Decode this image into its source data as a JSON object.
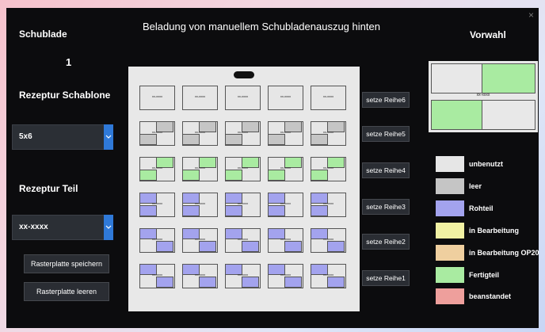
{
  "window": {
    "close_label": "×"
  },
  "sidebar": {
    "drawer_label": "Schublade",
    "drawer_number": "1",
    "template_label": "Rezeptur Schablone",
    "template_value": "5x6",
    "part_label": "Rezeptur Teil",
    "part_value": "xx-xxxx",
    "save_button": "Rasterplatte speichern",
    "clear_button": "Rasterplatte leeren"
  },
  "main": {
    "title": "Beladung von manuellem Schubladenauszug hinten",
    "cell_text": "xx-xxxx",
    "rows": [
      {
        "button": "setze Reihe6",
        "state": "unbenutzt"
      },
      {
        "button": "setze Reihe5",
        "state": "leer"
      },
      {
        "button": "setze Reihe4",
        "state": "Fertigteil"
      },
      {
        "button": "setze Reihe3",
        "state": "Rohteil"
      },
      {
        "button": "setze Reihe2",
        "state": "Rohteil"
      },
      {
        "button": "setze Reihe1",
        "state": "Rohteil"
      }
    ]
  },
  "preview": {
    "title": "Vorwahl",
    "cell_text": "xx-xxxx"
  },
  "legend": [
    {
      "label": "unbenutzt",
      "color": "#e6e6e6"
    },
    {
      "label": "leer",
      "color": "#c5c5c5"
    },
    {
      "label": "Rohteil",
      "color": "#a3a3ee"
    },
    {
      "label": "in Bearbeitung",
      "color": "#f1f1a3"
    },
    {
      "label": "in Bearbeitung OP20",
      "color": "#efcf9f"
    },
    {
      "label": "Fertigteil",
      "color": "#a9eba1"
    },
    {
      "label": "beanstandet",
      "color": "#ee9f9c"
    }
  ],
  "colors": {
    "panel": "#0c0c0e",
    "accent": "#2f79d8",
    "empty": "#c5c5c5",
    "raw": "#a3a3ee",
    "done": "#a9eba1"
  }
}
